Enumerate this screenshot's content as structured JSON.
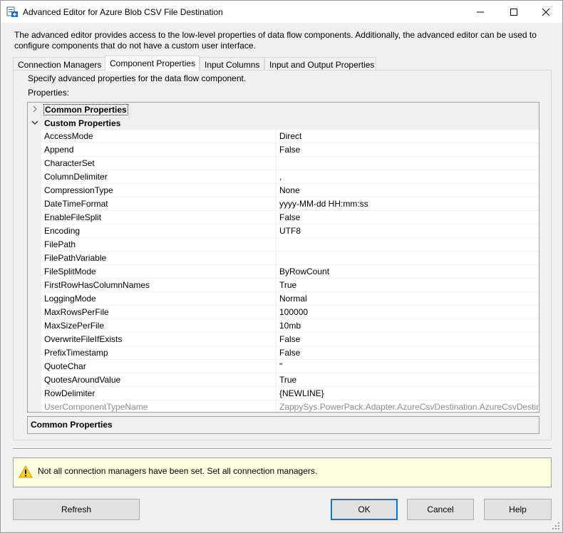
{
  "window": {
    "title": "Advanced Editor for Azure Blob CSV File Destination"
  },
  "description": "The advanced editor provides access to the low-level properties of data flow components. Additionally, the advanced editor can be used to configure components that do not have a custom user interface.",
  "tabs": [
    {
      "label": "Connection Managers",
      "active": false
    },
    {
      "label": "Component Properties",
      "active": true
    },
    {
      "label": "Input Columns",
      "active": false
    },
    {
      "label": "Input and Output Properties",
      "active": false
    }
  ],
  "panel": {
    "description": "Specify advanced properties for the data flow component.",
    "properties_label": "Properties:"
  },
  "grid": {
    "categories": [
      {
        "label": "Common Properties",
        "expanded": false
      },
      {
        "label": "Custom Properties",
        "expanded": true
      }
    ],
    "rows": [
      {
        "name": "AccessMode",
        "value": "Direct"
      },
      {
        "name": "Append",
        "value": "False"
      },
      {
        "name": "CharacterSet",
        "value": ""
      },
      {
        "name": "ColumnDelimiter",
        "value": ","
      },
      {
        "name": "CompressionType",
        "value": "None"
      },
      {
        "name": "DateTimeFormat",
        "value": "yyyy-MM-dd HH:mm:ss"
      },
      {
        "name": "EnableFileSplit",
        "value": "False"
      },
      {
        "name": "Encoding",
        "value": "UTF8"
      },
      {
        "name": "FilePath",
        "value": ""
      },
      {
        "name": "FilePathVariable",
        "value": ""
      },
      {
        "name": "FileSplitMode",
        "value": "ByRowCount"
      },
      {
        "name": "FirstRowHasColumnNames",
        "value": "True"
      },
      {
        "name": "LoggingMode",
        "value": "Normal"
      },
      {
        "name": "MaxRowsPerFile",
        "value": "100000"
      },
      {
        "name": "MaxSizePerFile",
        "value": "10mb"
      },
      {
        "name": "OverwriteFileIfExists",
        "value": "False"
      },
      {
        "name": "PrefixTimestamp",
        "value": "False"
      },
      {
        "name": "QuoteChar",
        "value": "\""
      },
      {
        "name": "QuotesAroundValue",
        "value": "True"
      },
      {
        "name": "RowDelimiter",
        "value": "{NEWLINE}"
      },
      {
        "name": "UserComponentTypeName",
        "value": "ZappySys.PowerPack.Adapter.AzureCsvDestination.AzureCsvDestinati",
        "readonly": true
      }
    ],
    "help_title": "Common Properties"
  },
  "warning": {
    "icon": "warning-icon",
    "text": "Not all connection managers have been set. Set all connection managers."
  },
  "buttons": {
    "refresh": "Refresh",
    "ok": "OK",
    "cancel": "Cancel",
    "help": "Help"
  },
  "colors": {
    "accent": "#0078d7",
    "warning_bg": "#ffffe1",
    "readonly_text": "#8d8d8d"
  }
}
